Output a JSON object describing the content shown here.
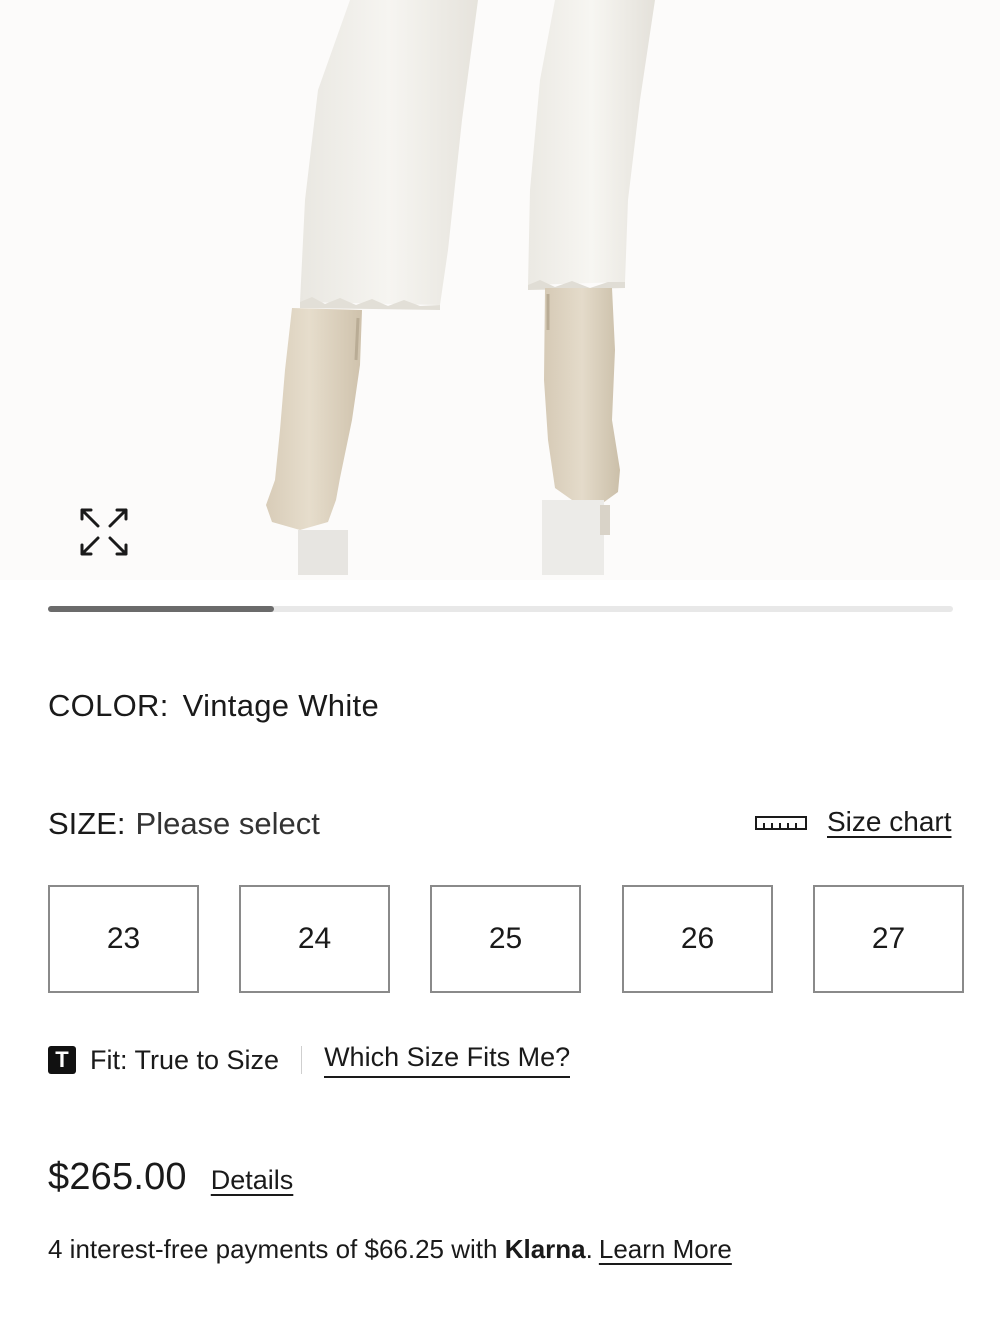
{
  "product_image": {
    "alt": "",
    "carousel_progress": 0.25
  },
  "icons": {
    "expand": "expand-arrows-icon",
    "ruler": "ruler-icon",
    "fit_badge": "T"
  },
  "color": {
    "label": "COLOR:",
    "value": "Vintage White"
  },
  "size": {
    "label": "SIZE:",
    "value": "Please select",
    "chart_link": "Size chart",
    "options": [
      "23",
      "24",
      "25",
      "26",
      "27"
    ]
  },
  "fit": {
    "text": "Fit: True to Size",
    "link": "Which Size Fits Me?"
  },
  "price": {
    "amount": "$265.00",
    "details_link": "Details"
  },
  "klarna": {
    "prefix": "4 interest-free payments of $66.25 with ",
    "brand": "Klarna",
    "suffix": ".",
    "link": "Learn More"
  },
  "colors": {
    "text": "#1a1a1a",
    "border": "#8a8a8a",
    "progress_fill": "#6b6b6b",
    "progress_track": "#e8e8e8"
  }
}
